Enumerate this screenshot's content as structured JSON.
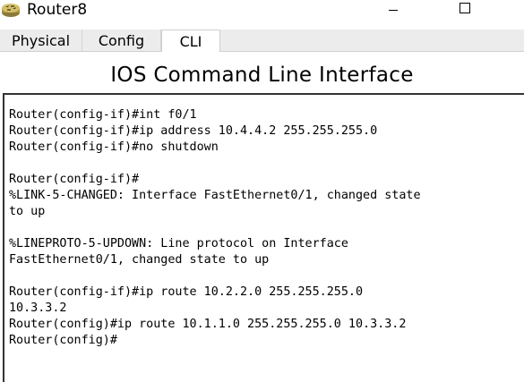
{
  "window": {
    "title": "Router8",
    "icon": "router-icon"
  },
  "tabs": [
    {
      "label": "Physical",
      "active": false
    },
    {
      "label": "Config",
      "active": false
    },
    {
      "label": "CLI",
      "active": true
    }
  ],
  "cli": {
    "heading": "IOS Command Line Interface",
    "lines": [
      "Router(config-if)#int f0/1",
      "Router(config-if)#ip address 10.4.4.2 255.255.255.0",
      "Router(config-if)#no shutdown",
      "",
      "Router(config-if)#",
      "%LINK-5-CHANGED: Interface FastEthernet0/1, changed state",
      "to up",
      "",
      "%LINEPROTO-5-UPDOWN: Line protocol on Interface",
      "FastEthernet0/1, changed state to up",
      "",
      "Router(config-if)#ip route 10.2.2.0 255.255.255.0",
      "10.3.3.2",
      "Router(config)#ip route 10.1.1.0 255.255.255.0 10.3.3.2",
      "Router(config)#"
    ]
  }
}
